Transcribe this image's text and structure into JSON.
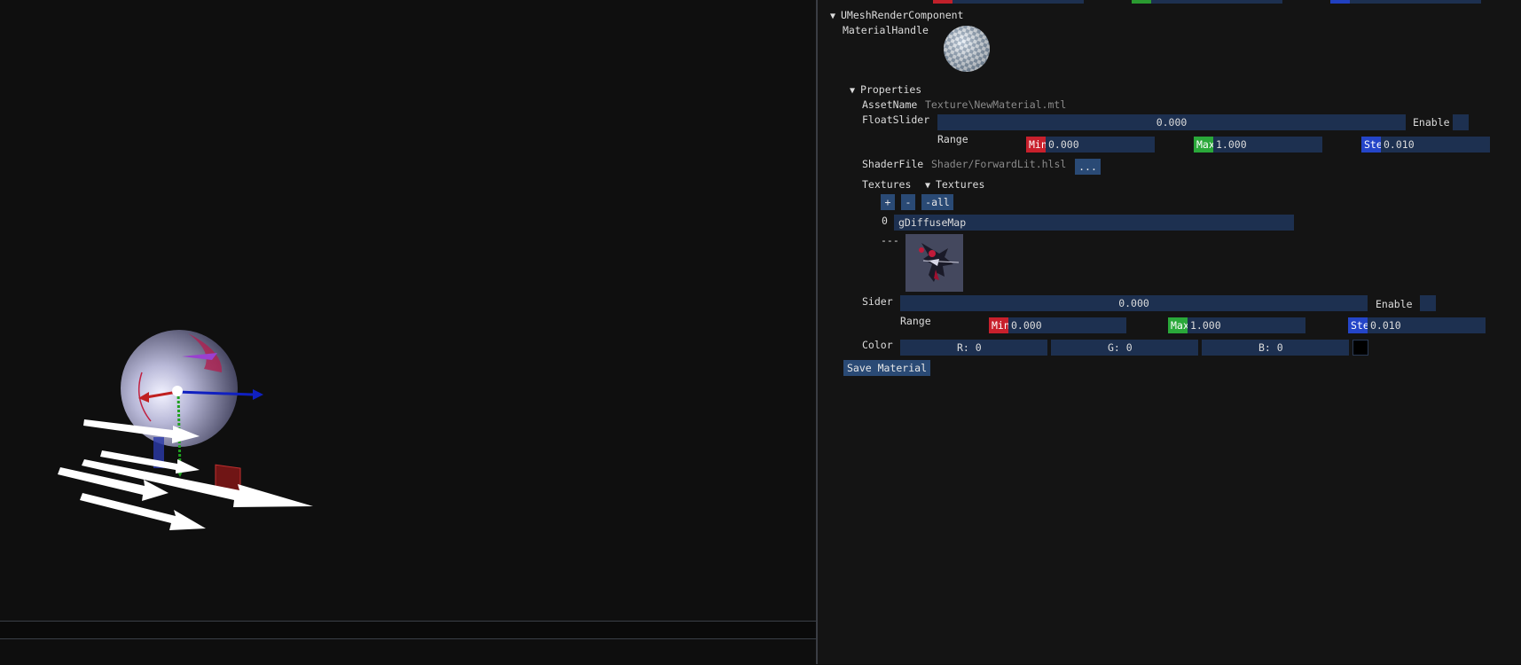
{
  "top_color_strips": [
    "#c0202a",
    "#2a9a30",
    "#2040c0"
  ],
  "component": {
    "title": "UMeshRenderComponent",
    "material_handle_label": "MaterialHandle"
  },
  "properties": {
    "title": "Properties",
    "asset_name_label": "AssetName",
    "asset_name_value": "Texture\\NewMaterial.mtl",
    "float_slider_label": "FloatSlider",
    "float_slider_value": "0.000",
    "float_slider_enable_label": "Enable",
    "float_slider_range_label": "Range",
    "float_slider_min_chip": "Min",
    "float_slider_min": "0.000",
    "float_slider_max_chip": "Max",
    "float_slider_max": "1.000",
    "float_slider_step_chip": "Step",
    "float_slider_step": "0.010",
    "shader_file_label": "ShaderFile",
    "shader_file_value": "Shader/ForwardLit.hlsl",
    "browse_button": "...",
    "textures_label": "Textures",
    "textures_tree_label": "Textures",
    "add_button": "+",
    "remove_button": "-",
    "remove_all_button": "-all",
    "texture_index": "0",
    "texture_name": "gDiffuseMap",
    "texture_separator": "---",
    "sider_label": "Sider",
    "sider_value": "0.000",
    "sider_enable_label": "Enable",
    "sider_range_label": "Range",
    "sider_min_chip": "Min",
    "sider_min": "0.000",
    "sider_max_chip": "Max",
    "sider_max": "1.000",
    "sider_step_chip": "Step",
    "sider_step": "0.010",
    "color_label": "Color",
    "color_r": "R:  0",
    "color_g": "G:  0",
    "color_b": "B:  0",
    "color_swatch": "#000000",
    "save_button": "Save Material"
  },
  "colors": {
    "chip_red": "#c8202c",
    "chip_green": "#2aa83a",
    "chip_blue": "#2445c8",
    "field_bg": "#1d3050",
    "button_bg": "#2a4a75"
  }
}
